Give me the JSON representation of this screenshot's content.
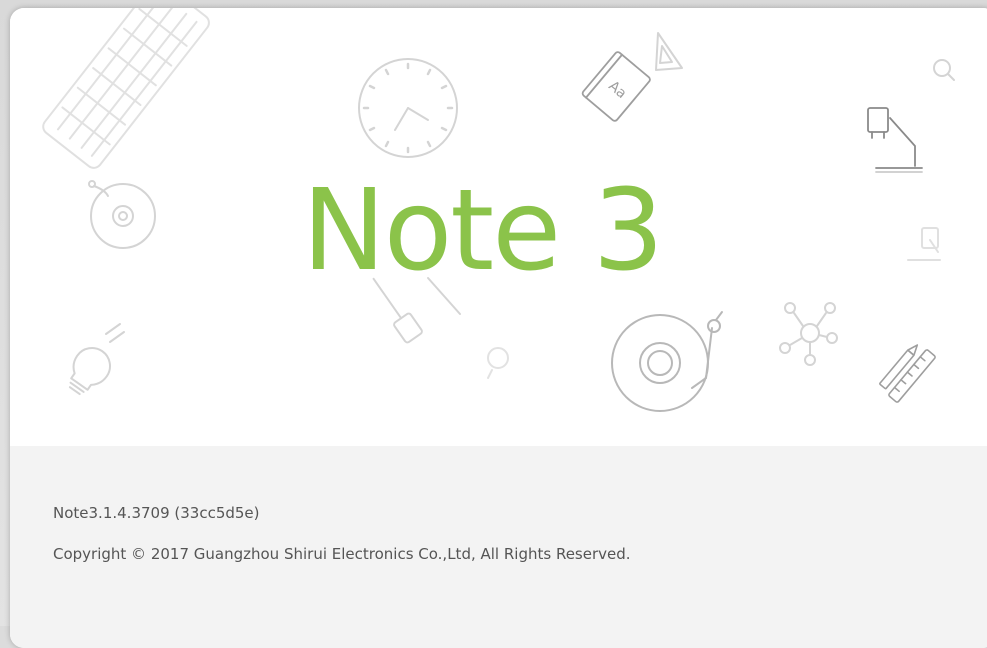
{
  "splash": {
    "title": "Note 3",
    "version": "Note3.1.4.3709 (33cc5d5e)",
    "copyright": "Copyright © 2017 Guangzhou Shirui Electronics Co.,Ltd, All Rights Reserved."
  },
  "colors": {
    "title_green": "#8bc34a",
    "footer_bg": "#f3f3f3",
    "footer_text": "#555555",
    "icon_stroke": "#cfcfcf"
  },
  "decorations": [
    "keyboard-icon",
    "clock-icon",
    "book-icon",
    "triangle-ruler-icon",
    "magnifier-icon",
    "desk-lamp-icon",
    "disc-icon",
    "chart-card-icon",
    "pen-icon",
    "lightbulb-icon",
    "small-bulb-icon",
    "turntable-icon",
    "molecule-icon",
    "pencil-ruler-icon"
  ]
}
